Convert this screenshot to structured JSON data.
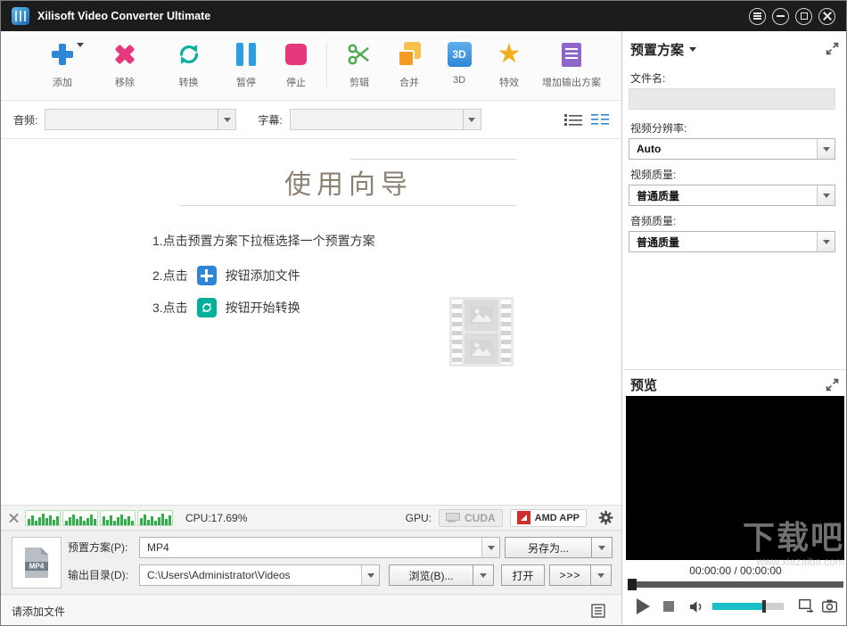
{
  "window": {
    "title": "Xilisoft Video Converter Ultimate"
  },
  "icons": {
    "star": "★"
  },
  "toolbar": {
    "items": [
      {
        "label": "添加"
      },
      {
        "label": "移除"
      },
      {
        "label": "转换"
      },
      {
        "label": "暂停"
      },
      {
        "label": "停止"
      },
      {
        "label": "剪辑"
      },
      {
        "label": "合并"
      },
      {
        "label": "3D"
      },
      {
        "label": "特效"
      },
      {
        "label": "增加输出方案"
      }
    ]
  },
  "filterbar": {
    "audio_label": "音频:",
    "subtitle_label": "字幕:"
  },
  "wizard": {
    "title": "使用向导",
    "step1": "1.点击预置方案下拉框选择一个预置方案",
    "step2_prefix": "2.点击",
    "step2_suffix": "按钮添加文件",
    "step3_prefix": "3.点击",
    "step3_suffix": "按钮开始转换"
  },
  "preset_panel": {
    "title": "预置方案",
    "filename_label": "文件名:",
    "filename_value": "",
    "resolution_label": "视频分辨率:",
    "resolution_value": "Auto",
    "video_quality_label": "视频质量:",
    "video_quality_value": "普通质量",
    "audio_quality_label": "音频质量:",
    "audio_quality_value": "普通质量"
  },
  "preview_panel": {
    "title": "预览",
    "time": "00:00:00 / 00:00:00"
  },
  "status_bar": {
    "cpu": "CPU:17.69%",
    "gpu_label": "GPU:",
    "cuda": "CUDA",
    "amd": "AMD APP"
  },
  "output": {
    "preset_label": "预置方案(P):",
    "preset_value": "MP4",
    "save_as": "另存为...",
    "dir_label": "输出目录(D):",
    "dir_value": "C:\\Users\\Administrator\\Videos",
    "browse": "浏览(B)...",
    "open": "打开",
    "more": ">>>"
  },
  "footer": {
    "status": "请添加文件"
  },
  "watermark": {
    "line1": "下载吧",
    "line2": "www.xiazaiba.com"
  }
}
